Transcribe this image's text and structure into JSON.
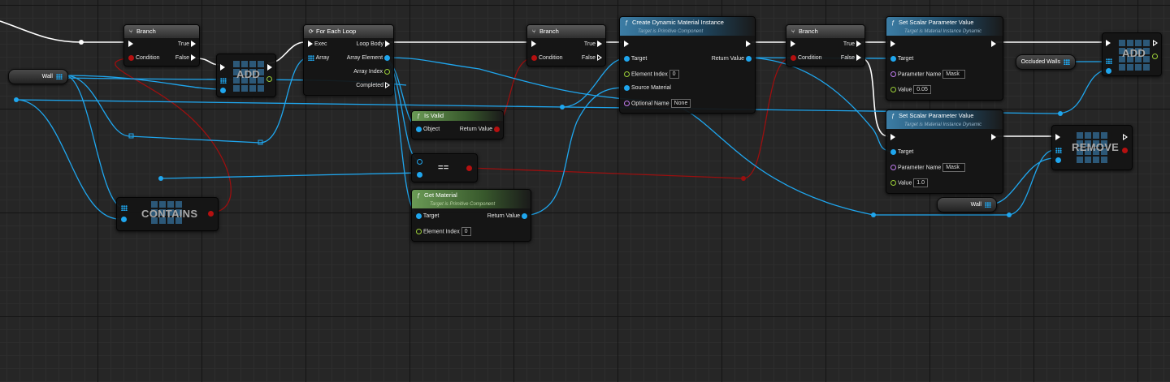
{
  "colors": {
    "exec_wire": "#ffffff",
    "object_wire": "#1fa6ee",
    "bool_wire": "#9b0f0f",
    "header_function": "#3c7da5",
    "header_pure": "#6a9a55",
    "header_flow": "#5a5a5a"
  },
  "icons": {
    "branch": "branch-icon",
    "loop": "loop-icon",
    "function": "function-icon",
    "array": "array-grid-icon",
    "exec": "exec-arrow-icon"
  },
  "nodes": {
    "branch1": {
      "title": "Branch",
      "true_label": "True",
      "false_label": "False",
      "condition_label": "Condition"
    },
    "add1": {
      "label": "ADD"
    },
    "wall_var1": {
      "label": "Wall"
    },
    "contains": {
      "label": "CONTAINS"
    },
    "foreach": {
      "title": "For Each Loop",
      "exec_label": "Exec",
      "array_label": "Array",
      "loop_body_label": "Loop Body",
      "array_element_label": "Array Element",
      "array_index_label": "Array Index",
      "completed_label": "Completed"
    },
    "isvalid": {
      "title": "Is Valid",
      "object_label": "Object",
      "return_label": "Return Value"
    },
    "equals": {
      "label": "=="
    },
    "getmaterial": {
      "title": "Get Material",
      "subtitle": "Target is Primitive Component",
      "target_label": "Target",
      "return_label": "Return Value",
      "element_index_label": "Element Index",
      "element_index_value": "0"
    },
    "branch2": {
      "title": "Branch",
      "true_label": "True",
      "false_label": "False",
      "condition_label": "Condition"
    },
    "createdmi": {
      "title": "Create Dynamic Material Instance",
      "subtitle": "Target is Primitive Component",
      "target_label": "Target",
      "return_label": "Return Value",
      "element_index_label": "Element Index",
      "element_index_value": "0",
      "source_label": "Source Material",
      "optional_name_label": "Optional Name",
      "optional_name_value": "None"
    },
    "branch3": {
      "title": "Branch",
      "true_label": "True",
      "false_label": "False",
      "condition_label": "Condition"
    },
    "setscalar1": {
      "title": "Set Scalar Parameter Value",
      "subtitle": "Target is Material Instance Dynamic",
      "target_label": "Target",
      "param_label": "Parameter Name",
      "param_value": "Mask",
      "value_label": "Value",
      "value_value": "0.05"
    },
    "setscalar2": {
      "title": "Set Scalar Parameter Value",
      "subtitle": "Target is Material Instance Dynamic",
      "target_label": "Target",
      "param_label": "Parameter Name",
      "param_value": "Mask",
      "value_label": "Value",
      "value_value": "1.0"
    },
    "occluded_var": {
      "label": "Occluded Walls"
    },
    "add2": {
      "label": "ADD"
    },
    "remove": {
      "label": "REMOVE"
    },
    "wall_var2": {
      "label": "Wall"
    }
  }
}
